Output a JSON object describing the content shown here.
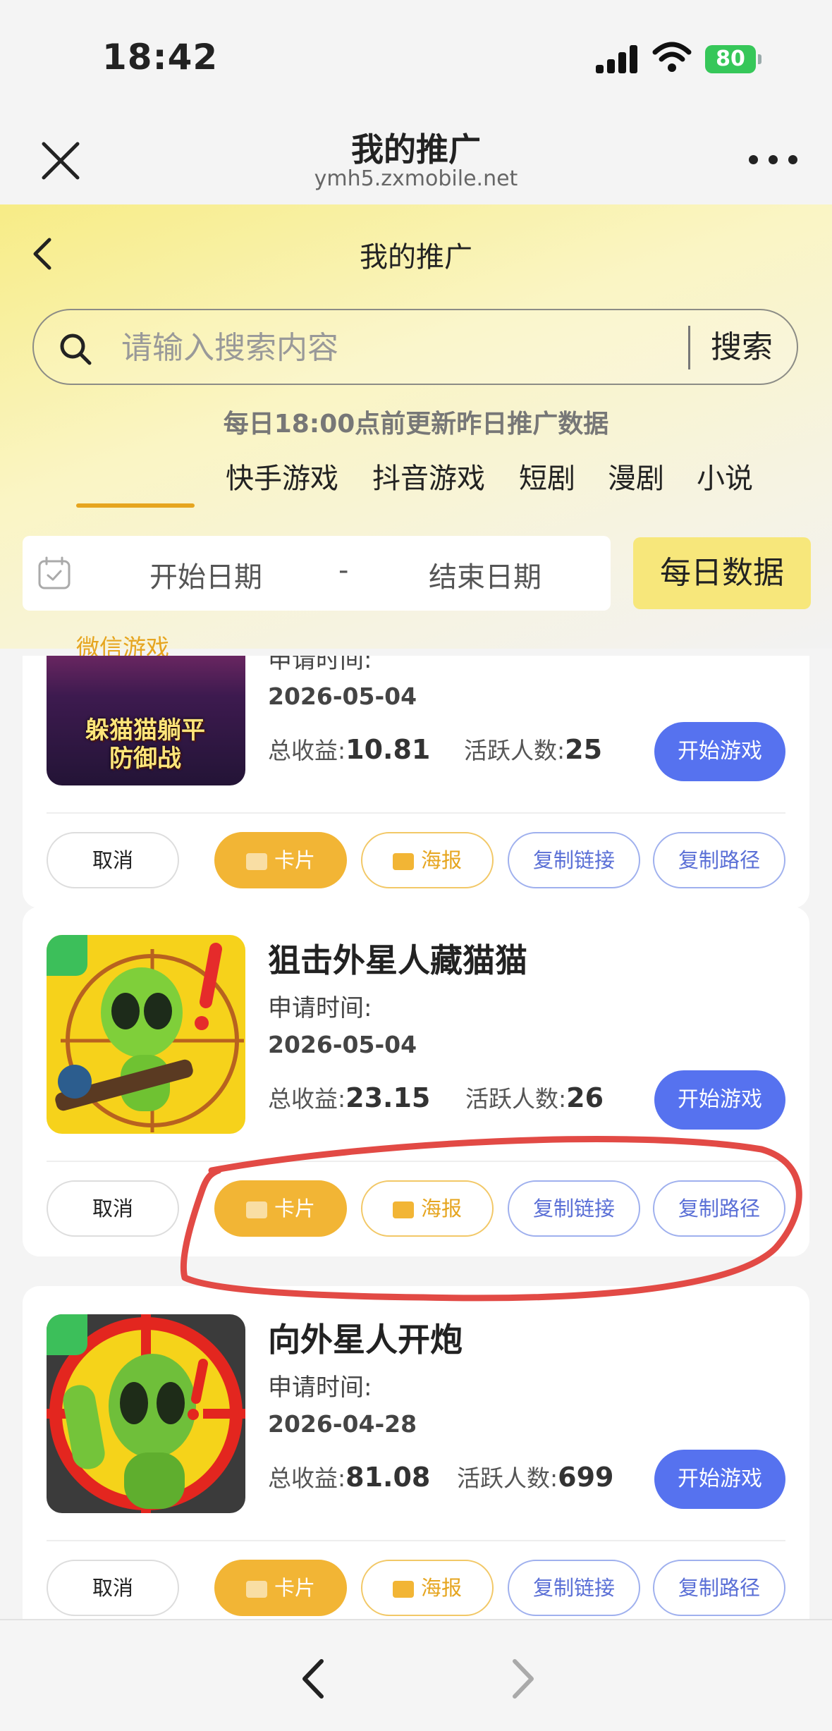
{
  "status_bar": {
    "time": "18:42",
    "battery": "80"
  },
  "nav": {
    "title": "我的推广",
    "domain": "ymh5.zxmobile.net"
  },
  "page": {
    "title": "我的推广"
  },
  "search": {
    "placeholder": "请输入搜索内容",
    "button_label": "搜索"
  },
  "notice": "每日18:00点前更新昨日推广数据",
  "tabs": [
    {
      "label": "微信游戏",
      "active": true
    },
    {
      "label": "快手游戏"
    },
    {
      "label": "抖音游戏"
    },
    {
      "label": "短剧"
    },
    {
      "label": "漫剧"
    },
    {
      "label": "小说"
    }
  ],
  "date_filter": {
    "start": "开始日期",
    "separator": "-",
    "end": "结束日期",
    "daily_button": "每日数据"
  },
  "labels": {
    "apply_time": "申请时间:",
    "total_earnings": "总收益:",
    "active_users": "活跃人数:",
    "start_game": "开始游戏",
    "cancel": "取消",
    "card": "卡片",
    "poster": "海报",
    "copy_link": "复制链接",
    "copy_path": "复制路径"
  },
  "games": [
    {
      "thumb_text": "躲猫猫躺平防御战",
      "apply_date": "2026-05-04",
      "earnings": "10.81",
      "active_users": "25"
    },
    {
      "title": "狙击外星人藏猫猫",
      "apply_date": "2026-05-04",
      "earnings": "23.15",
      "active_users": "26"
    },
    {
      "title": "向外星人开炮",
      "apply_date": "2026-04-28",
      "earnings": "81.08",
      "active_users": "699"
    }
  ],
  "colors": {
    "accent_yellow": "#e6a51f",
    "primary_blue": "#5672ef",
    "annotation_red": "#e24a45"
  }
}
